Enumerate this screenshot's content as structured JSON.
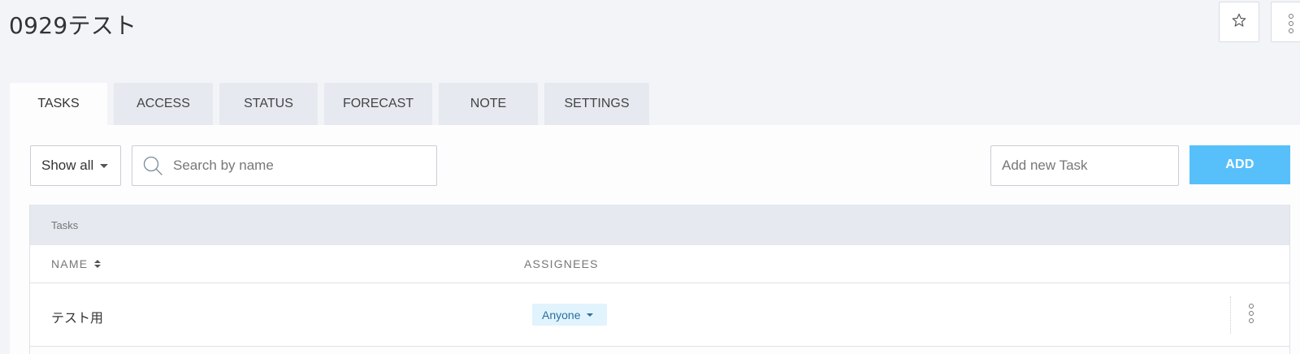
{
  "header": {
    "title": "0929テスト",
    "star_icon": "star-icon",
    "more_icon": "more-vertical-icon"
  },
  "tabs": [
    {
      "label": "TASKS",
      "active": true
    },
    {
      "label": "ACCESS",
      "active": false
    },
    {
      "label": "STATUS",
      "active": false
    },
    {
      "label": "FORECAST",
      "active": false
    },
    {
      "label": "NOTE",
      "active": false
    },
    {
      "label": "SETTINGS",
      "active": false
    }
  ],
  "toolbar": {
    "filter_value": "Show all",
    "search_placeholder": "Search by name",
    "new_task_placeholder": "Add new Task",
    "add_label": "ADD"
  },
  "table": {
    "caption": "Tasks",
    "columns": {
      "name": "NAME",
      "assignees": "ASSIGNEES"
    },
    "rows": [
      {
        "name": "テスト用",
        "assignee": "Anyone"
      }
    ]
  },
  "colors": {
    "accent": "#57c0fb",
    "page_bg": "#f2f4f8",
    "tab_bg": "#e6e9ef",
    "chip_bg": "#e1f3fd",
    "chip_text": "#2b6ea0"
  }
}
